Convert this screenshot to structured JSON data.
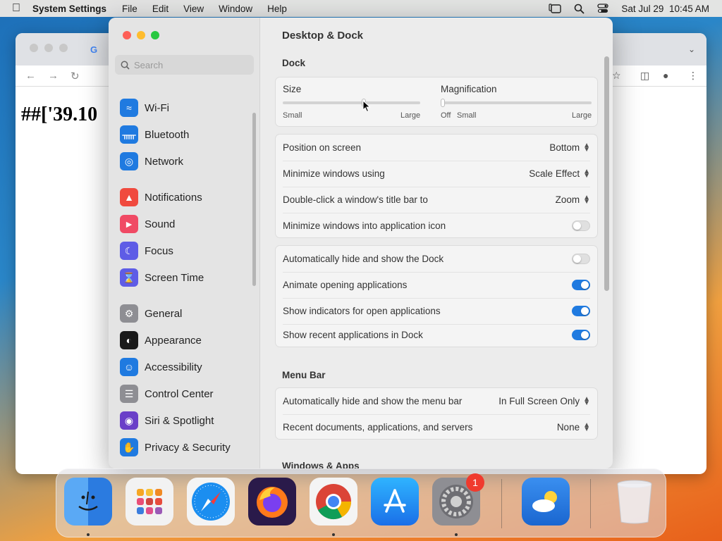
{
  "menubar": {
    "app_name": "System Settings",
    "menus": [
      "File",
      "Edit",
      "View",
      "Window",
      "Help"
    ],
    "datetime": "Sat Jul 29  10:45 AM"
  },
  "browser": {
    "page_text": "##['39.10"
  },
  "sidebar": {
    "search_placeholder": "Search",
    "items": [
      {
        "label": "Wi-Fi",
        "icon": "wifi-icon",
        "color": "#1f7ae0"
      },
      {
        "label": "Bluetooth",
        "icon": "bluetooth-icon",
        "color": "#1f7ae0"
      },
      {
        "label": "Network",
        "icon": "globe-icon",
        "color": "#1f7ae0"
      },
      {
        "label": "Notifications",
        "icon": "bell-icon",
        "color": "#f04a3e"
      },
      {
        "label": "Sound",
        "icon": "speaker-icon",
        "color": "#f04a64"
      },
      {
        "label": "Focus",
        "icon": "moon-icon",
        "color": "#5e5ce6"
      },
      {
        "label": "Screen Time",
        "icon": "hourglass-icon",
        "color": "#5e5ce6"
      },
      {
        "label": "General",
        "icon": "gear-icon",
        "color": "#8e8e93"
      },
      {
        "label": "Appearance",
        "icon": "appearance-icon",
        "color": "#1a1a1a"
      },
      {
        "label": "Accessibility",
        "icon": "accessibility-icon",
        "color": "#1f7ae0"
      },
      {
        "label": "Control Center",
        "icon": "control-center-icon",
        "color": "#8e8e93"
      },
      {
        "label": "Siri & Spotlight",
        "icon": "siri-icon",
        "color": "#6a3fc8"
      },
      {
        "label": "Privacy & Security",
        "icon": "hand-icon",
        "color": "#1f7ae0"
      }
    ]
  },
  "main": {
    "title": "Desktop & Dock",
    "dock_section": "Dock",
    "size": {
      "label": "Size",
      "min_label": "Small",
      "max_label": "Large",
      "value": 0.59
    },
    "magnification": {
      "label": "Magnification",
      "off_label": "Off",
      "min_label": "Small",
      "max_label": "Large",
      "value": 0.0
    },
    "popups": [
      {
        "label": "Position on screen",
        "value": "Bottom"
      },
      {
        "label": "Minimize windows using",
        "value": "Scale Effect"
      },
      {
        "label": "Double-click a window's title bar to",
        "value": "Zoom"
      }
    ],
    "minimize_into_icon": {
      "label": "Minimize windows into application icon",
      "on": false
    },
    "toggles": [
      {
        "label": "Automatically hide and show the Dock",
        "on": false
      },
      {
        "label": "Animate opening applications",
        "on": true
      },
      {
        "label": "Show indicators for open applications",
        "on": true
      },
      {
        "label": "Show recent applications in Dock",
        "on": true
      }
    ],
    "menubar_section": "Menu Bar",
    "menubar_rows": [
      {
        "label": "Automatically hide and show the menu bar",
        "value": "In Full Screen Only"
      },
      {
        "label": "Recent documents, applications, and servers",
        "value": "None"
      }
    ],
    "windows_section": "Windows & Apps"
  },
  "dock": {
    "apps": [
      {
        "name": "finder",
        "running": true
      },
      {
        "name": "launchpad",
        "running": false
      },
      {
        "name": "safari",
        "running": false
      },
      {
        "name": "firefox",
        "running": false
      },
      {
        "name": "chrome",
        "running": true
      },
      {
        "name": "app-store",
        "running": false
      },
      {
        "name": "system-settings",
        "running": true,
        "badge": "1"
      },
      {
        "name": "weather",
        "running": false
      },
      {
        "name": "trash",
        "running": false
      }
    ]
  }
}
